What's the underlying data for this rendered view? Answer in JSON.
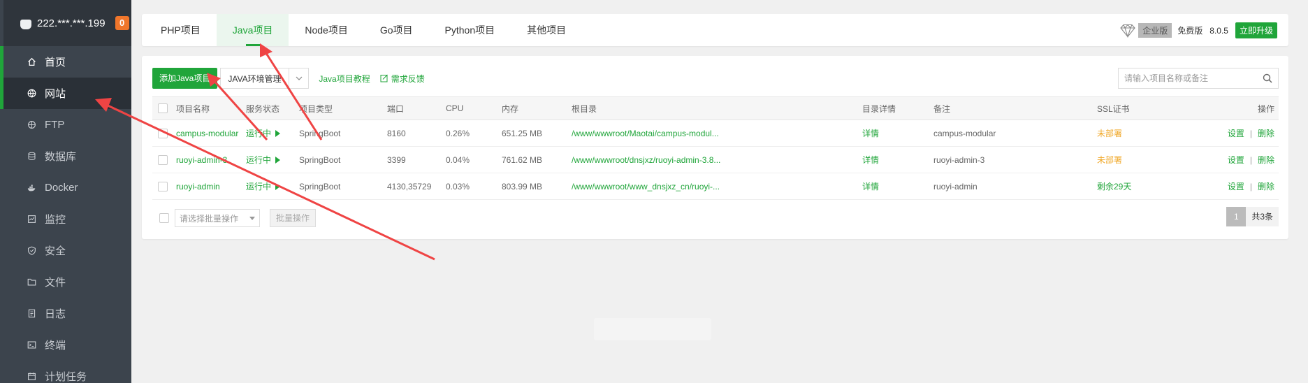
{
  "sidebar": {
    "ip": "222.***.***.199",
    "badge": "0",
    "items": [
      {
        "label": "首页",
        "icon": "home-icon"
      },
      {
        "label": "网站",
        "icon": "globe-icon"
      },
      {
        "label": "FTP",
        "icon": "ftp-icon"
      },
      {
        "label": "数据库",
        "icon": "database-icon"
      },
      {
        "label": "Docker",
        "icon": "docker-icon"
      },
      {
        "label": "监控",
        "icon": "monitor-icon"
      },
      {
        "label": "安全",
        "icon": "shield-icon"
      },
      {
        "label": "文件",
        "icon": "folder-icon"
      },
      {
        "label": "日志",
        "icon": "log-icon"
      },
      {
        "label": "终端",
        "icon": "terminal-icon"
      },
      {
        "label": "计划任务",
        "icon": "calendar-icon"
      }
    ]
  },
  "tabs": [
    "PHP项目",
    "Java项目",
    "Node项目",
    "Go项目",
    "Python项目",
    "其他项目"
  ],
  "version": {
    "enterprise": "企业版",
    "free": "免费版",
    "number": "8.0.5",
    "upgrade": "立即升级"
  },
  "toolbar": {
    "add": "添加Java项目",
    "env": "JAVA环境管理",
    "tutorial": "Java项目教程",
    "feedback": "需求反馈",
    "search_placeholder": "请输入项目名称或备注"
  },
  "table": {
    "headers": [
      "项目名称",
      "服务状态",
      "项目类型",
      "端口",
      "CPU",
      "内存",
      "根目录",
      "目录详情",
      "备注",
      "SSL证书",
      "操作"
    ],
    "rows": [
      {
        "name": "campus-modular",
        "status": "运行中",
        "type": "SpringBoot",
        "port": "8160",
        "cpu": "0.26%",
        "mem": "651.25 MB",
        "root": "/www/wwwroot/Maotai/campus-modul...",
        "detail": "详情",
        "note": "campus-modular",
        "ssl": "未部署"
      },
      {
        "name": "ruoyi-admin-3",
        "status": "运行中",
        "type": "SpringBoot",
        "port": "3399",
        "cpu": "0.04%",
        "mem": "761.62 MB",
        "root": "/www/wwwroot/dnsjxz/ruoyi-admin-3.8...",
        "detail": "详情",
        "note": "ruoyi-admin-3",
        "ssl": "未部署"
      },
      {
        "name": "ruoyi-admin",
        "status": "运行中",
        "type": "SpringBoot",
        "port": "4130,35729",
        "cpu": "0.03%",
        "mem": "803.99 MB",
        "root": "/www/wwwroot/www_dnsjxz_cn/ruoyi-...",
        "detail": "详情",
        "note": "ruoyi-admin",
        "ssl": "剩余29天"
      }
    ],
    "actions": {
      "settings": "设置",
      "separator": "|",
      "delete": "删除"
    }
  },
  "footer": {
    "batch_placeholder": "请选择批量操作",
    "batch_button": "批量操作",
    "page": "1",
    "total": "共3条"
  },
  "colors": {
    "accent": "#20a53a",
    "warning": "#f0a92b",
    "badge": "#f0762b",
    "annotation_arrow": "#ef4444"
  }
}
